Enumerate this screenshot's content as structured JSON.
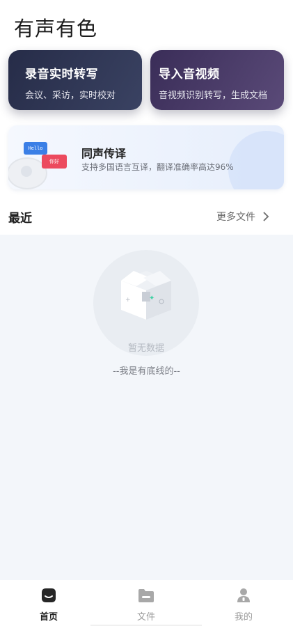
{
  "header": {
    "title": "有声有色"
  },
  "cards": {
    "record": {
      "title": "录音实时转写",
      "subtitle": "会议、采访，实时校对"
    },
    "import": {
      "title": "导入音视频",
      "subtitle": "音视频识别转写，生成文档"
    }
  },
  "banner": {
    "title": "同声传译",
    "subtitle": "支持多国语言互译，翻译准确率高达96%",
    "bubble_en": "Hello",
    "bubble_zh": "你好"
  },
  "recent": {
    "title": "最近",
    "more_label": "更多文件",
    "empty_text": "暂无数据",
    "footer_text": "--我是有底线的--"
  },
  "tabbar": {
    "items": [
      {
        "label": "首页",
        "icon": "home-icon",
        "active": true,
        "color": "#222222"
      },
      {
        "label": "文件",
        "icon": "folder-icon",
        "active": false,
        "color": "#9a9a9a"
      },
      {
        "label": "我的",
        "icon": "user-icon",
        "active": false,
        "color": "#9a9a9a"
      }
    ]
  },
  "colors": {
    "record_card": "#2c3350",
    "import_card": "#4a3c6a",
    "hello_bubble": "#3b7fe6",
    "nihao_bubble": "#ec4a5e",
    "content_bg": "#f3f6fa"
  }
}
